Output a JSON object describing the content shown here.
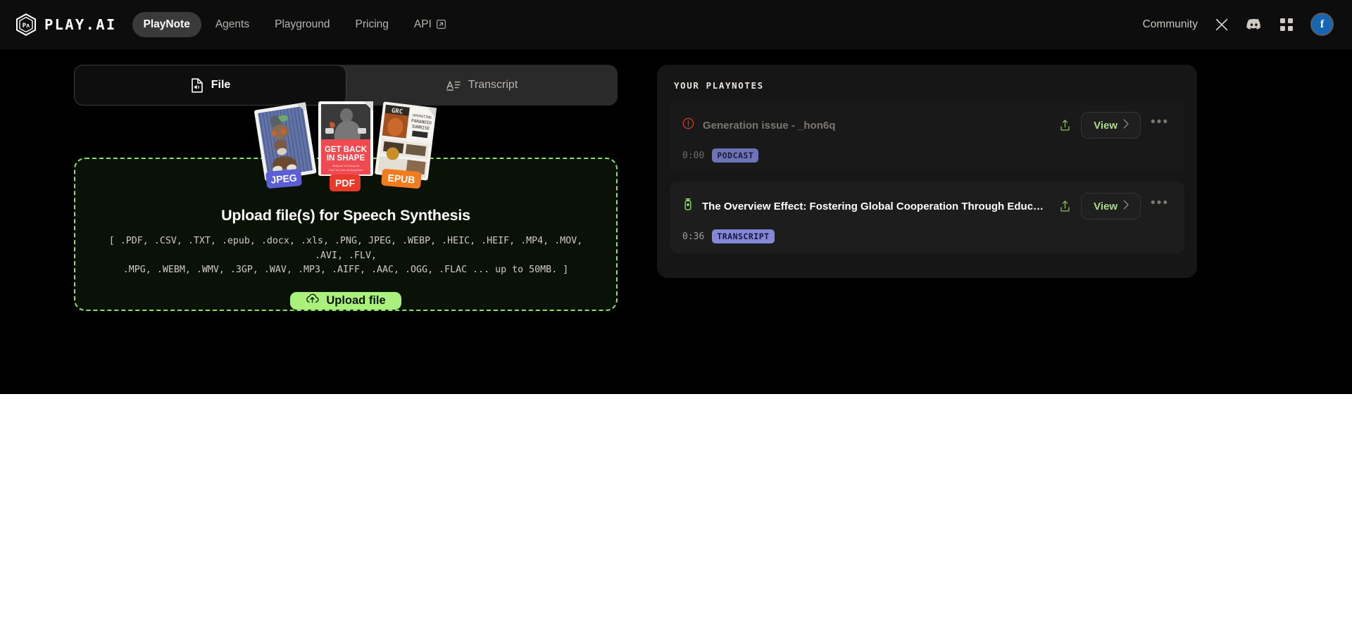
{
  "header": {
    "brand": "PLAY.AI",
    "logo_icon": "play-ai-cube-logo",
    "nav": [
      {
        "label": "PlayNote",
        "active": true
      },
      {
        "label": "Agents",
        "active": false
      },
      {
        "label": "Playground",
        "active": false
      },
      {
        "label": "Pricing",
        "active": false
      },
      {
        "label": "API",
        "active": false,
        "external_icon": "external-link-icon"
      }
    ],
    "community_label": "Community",
    "x_icon": "x-twitter-icon",
    "discord_icon": "discord-icon",
    "apps_icon": "grid-apps-icon",
    "avatar_letter": "f",
    "avatar_color": "#1766b5"
  },
  "tabs": [
    {
      "label": "File",
      "icon": "file-audio-icon",
      "active": true
    },
    {
      "label": "Transcript",
      "icon": "text-lines-icon",
      "active": false
    }
  ],
  "upload": {
    "title": "Upload file(s) for Speech Synthesis",
    "formats": "[ .PDF, .CSV, .TXT, .epub, .docx, .xls, .PNG, JPEG, .WEBP, .HEIC, .HEIF, .MP4, .MOV, .AVI, .FLV,\n.MPG, .WEBM, .WMV, .3GP, .WAV, .MP3, .AIFF, .AAC, .OGG, .FLAC ... up to 50MB. ]",
    "button_label": "Upload file",
    "button_icon": "cloud-upload-icon",
    "button_color": "#a9f07c",
    "border_color": "#8fe06a",
    "doc_badges": [
      {
        "label": "JPEG",
        "color": "#5b5fd6"
      },
      {
        "label": "PDF",
        "color": "#e8392d"
      },
      {
        "label": "EPUB",
        "color": "#f07c1f"
      }
    ]
  },
  "playnotes": {
    "panel_title": "YOUR PLAYNOTES",
    "items": [
      {
        "title": "Generation issue - _hon6q",
        "status_icon": "alert-circle-icon",
        "status_color": "#d2391e",
        "muted": true,
        "time": "0:00",
        "badge": "PODCAST",
        "share_icon": "share-upload-icon",
        "view_label": "View",
        "chevron_icon": "chevron-right-icon",
        "more_icon": "ellipsis-icon"
      },
      {
        "title": "The Overview Effect: Fostering Global Cooperation Through Educa...",
        "status_icon": "podcast-mic-icon",
        "status_color": "#8fe06a",
        "muted": false,
        "time": "0:36",
        "badge": "TRANSCRIPT",
        "share_icon": "share-upload-icon",
        "view_label": "View",
        "chevron_icon": "chevron-right-icon",
        "more_icon": "ellipsis-icon"
      }
    ]
  }
}
